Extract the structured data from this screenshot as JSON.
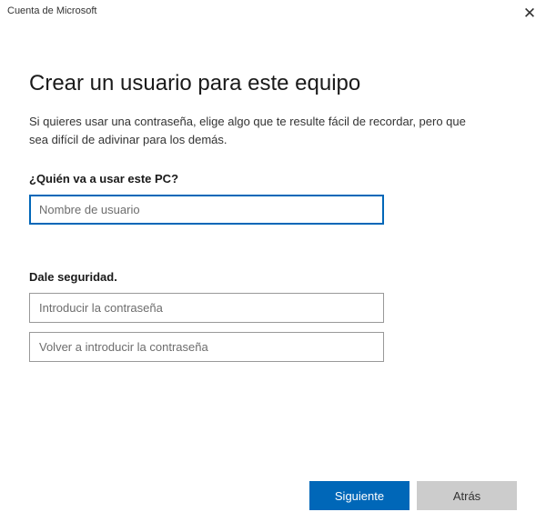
{
  "titlebar": {
    "title": "Cuenta de Microsoft"
  },
  "page": {
    "heading": "Crear un usuario para este equipo",
    "subtitle": "Si quieres usar una contraseña, elige algo que te resulte fácil de recordar, pero que sea difícil de adivinar para los demás."
  },
  "form": {
    "username_label": "¿Quién va a usar este PC?",
    "username_placeholder": "Nombre de usuario",
    "security_label": "Dale seguridad.",
    "password_placeholder": "Introducir la contraseña",
    "password_confirm_placeholder": "Volver a introducir la contraseña"
  },
  "buttons": {
    "next": "Siguiente",
    "back": "Atrás"
  }
}
